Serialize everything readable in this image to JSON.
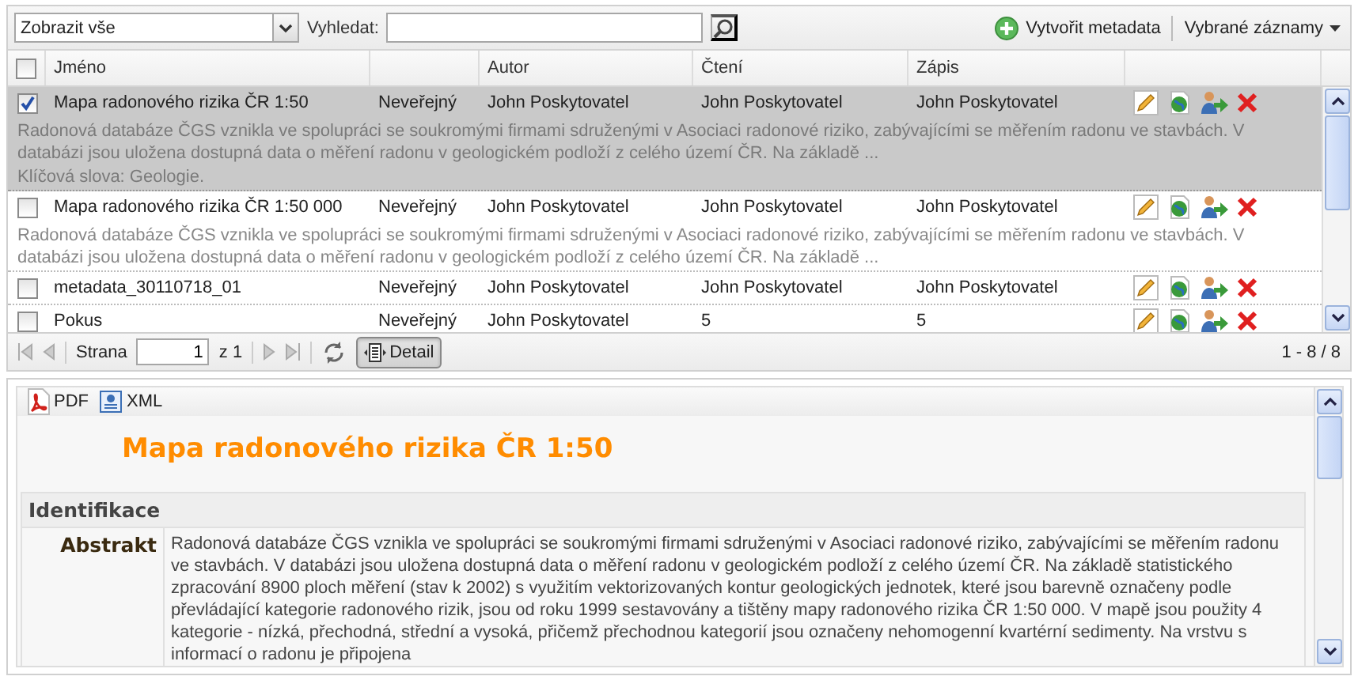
{
  "toolbar": {
    "filter": {
      "value": "Zobrazit vše"
    },
    "search": {
      "label": "Vyhledat:"
    },
    "create": "Vytvořit metadata",
    "selected_menu": "Vybrané záznamy"
  },
  "table": {
    "all_checked": false,
    "columns": {
      "name": "Jméno",
      "author": "Autor",
      "read": "Čtení",
      "write": "Zápis"
    },
    "rows": [
      {
        "name": "Mapa radonového rizika ČR 1:50",
        "status": "Neveřejný",
        "author": "John Poskytovatel",
        "read": "John Poskytovatel",
        "write": "John Poskytovatel",
        "checked": true,
        "selected": true,
        "description": "Radonová databáze ČGS vznikla ve spolupráci se soukromými firmami sdruženými v Asociaci radonové riziko, zabývajícími se měřením radonu ve stavbách. V databázi jsou uložena dostupná data o měření radonu v geologickém podloží z celého území ČR. Na základě ...",
        "keywords": "Klíčová slova: Geologie."
      },
      {
        "name": "Mapa radonového rizika ČR 1:50 000",
        "status": "Neveřejný",
        "author": "John Poskytovatel",
        "read": "John Poskytovatel",
        "write": "John Poskytovatel",
        "checked": false,
        "selected": false,
        "description": "Radonová databáze ČGS vznikla ve spolupráci se soukromými firmami sdruženými v Asociaci radonové riziko, zabývajícími se měřením radonu ve stavbách. V databázi jsou uložena dostupná data o měření radonu v geologickém podloží z celého území ČR. Na základě ..."
      },
      {
        "name": "metadata_30110718_01",
        "status": "Neveřejný",
        "author": "John Poskytovatel",
        "read": "John Poskytovatel",
        "write": "John Poskytovatel",
        "checked": false,
        "selected": false
      },
      {
        "name": "Pokus",
        "status": "Neveřejný",
        "author": "John Poskytovatel",
        "read": "5",
        "write": "5",
        "checked": false,
        "selected": false
      }
    ]
  },
  "pager": {
    "page_label": "Strana",
    "page": "1",
    "of": "z 1",
    "detail_label": "Detail",
    "detail_pressed": true,
    "summary": "1 - 8 / 8"
  },
  "detail": {
    "pdf": "PDF",
    "xml": "XML",
    "title": "Mapa radonového rizika ČR 1:50",
    "section": "Identifikace",
    "fields": [
      {
        "label": "Abstrakt",
        "value": "Radonová databáze ČGS vznikla ve spolupráci se soukromými firmami sdruženými v Asociaci radonové riziko, zabývajícími se měřením radonu ve stavbách. V databázi jsou uložena dostupná data o měření radonu v geologickém podloží z celého území ČR. Na základě statistického zpracování 8900 ploch měření (stav k 2002) s využitím vektorizovaných kontur geologických jednotek, které jsou barevně označeny podle převládající kategorie radonového rizik, jsou od roku 1999 sestavovány a tištěny mapy radonového rizika ČR 1:50 000. V mapě jsou použity 4 kategorie - nízká, přechodná, střední a vysoká, přičemž přechodnou kategorií jsou označeny nehomogenní kvartérní sedimenty. Na vrstvu s informací o radonu je připojena"
      }
    ]
  }
}
